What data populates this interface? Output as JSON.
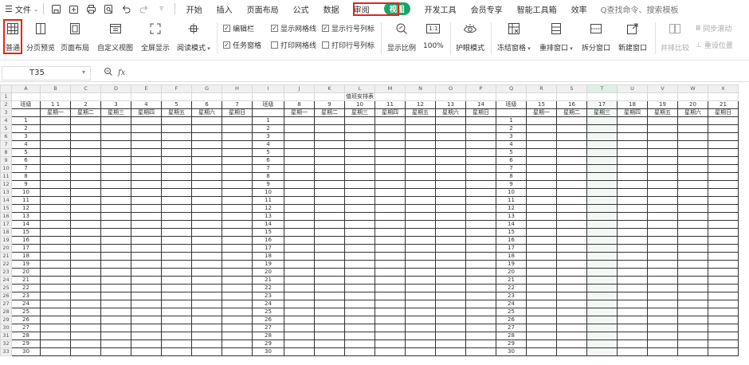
{
  "menu": {
    "file_label": "文件",
    "tabs": [
      "开始",
      "插入",
      "页面布局",
      "公式",
      "数据",
      "审阅",
      "视图",
      "开发工具",
      "会员专享",
      "智能工具箱",
      "效率"
    ],
    "active_tab": "视图",
    "search_text": "Q查找命令、搜索模板"
  },
  "ribbon": {
    "normal": "普通",
    "page_break": "分页预览",
    "page_layout": "页面布局",
    "custom_view": "自定义视图",
    "full_screen": "全屏显示",
    "reading_mode": "阅读模式",
    "cb_edit_bar": "编辑栏",
    "cb_show_grid": "显示网格线",
    "cb_show_rowcol": "显示行号列标",
    "cb_task_pane": "任务窗格",
    "cb_print_grid": "打印网格线",
    "cb_print_rowcol": "打印行号列标",
    "zoom_ratio": "显示比例",
    "zoom_100": "100%",
    "eye_mode": "护眼模式",
    "freeze": "冻结窗格",
    "arrange": "重排窗口",
    "split": "拆分窗口",
    "new_window": "新建窗口",
    "side_by_side": "并排比较",
    "sync_scroll": "同步滚动",
    "reset_pos": "重设位置",
    "one_to_one": "1:1"
  },
  "formula_bar": {
    "cell_ref": "T35",
    "fx": "fx"
  },
  "sheet": {
    "columns": [
      "A",
      "B",
      "C",
      "D",
      "E",
      "F",
      "G",
      "H",
      "I",
      "J",
      "K",
      "L",
      "M",
      "N",
      "O",
      "P",
      "Q",
      "R",
      "S",
      "T",
      "U",
      "V",
      "W",
      "X"
    ],
    "selected_column": "T",
    "title": "值班安排表",
    "class_label": "班级",
    "day_nums_1": [
      "1 1",
      "2",
      "3",
      "4",
      "5",
      "6",
      "7"
    ],
    "day_nums_2": [
      "8",
      "9",
      "10",
      "11",
      "12",
      "13",
      "14"
    ],
    "day_nums_3": [
      "15",
      "16",
      "17",
      "18",
      "19",
      "20",
      "21"
    ],
    "weekdays": [
      "星期一",
      "星期二",
      "星期三",
      "星期四",
      "星期五",
      "星期六",
      "星期日"
    ],
    "class_numbers": [
      "1",
      "2",
      "3",
      "4",
      "5",
      "6",
      "7",
      "8",
      "9",
      "10",
      "11",
      "12",
      "13",
      "14",
      "15",
      "16",
      "17",
      "18",
      "19",
      "20",
      "21",
      "22",
      "23",
      "24",
      "25",
      "26",
      "27",
      "28",
      "29",
      "30"
    ],
    "row_numbers": [
      "1",
      "2",
      "3",
      "4",
      "5",
      "6",
      "7",
      "8",
      "9",
      "10",
      "11",
      "12",
      "13",
      "14",
      "15",
      "16",
      "17",
      "18",
      "19",
      "20",
      "21",
      "22",
      "23",
      "24",
      "25",
      "26",
      "27",
      "28",
      "29",
      "30",
      "31",
      "32",
      "33"
    ]
  },
  "colors": {
    "active_tab_bg": "#1aa568",
    "highlight_box": "#e5231c",
    "selected_col_bg": "#e0eee6"
  }
}
